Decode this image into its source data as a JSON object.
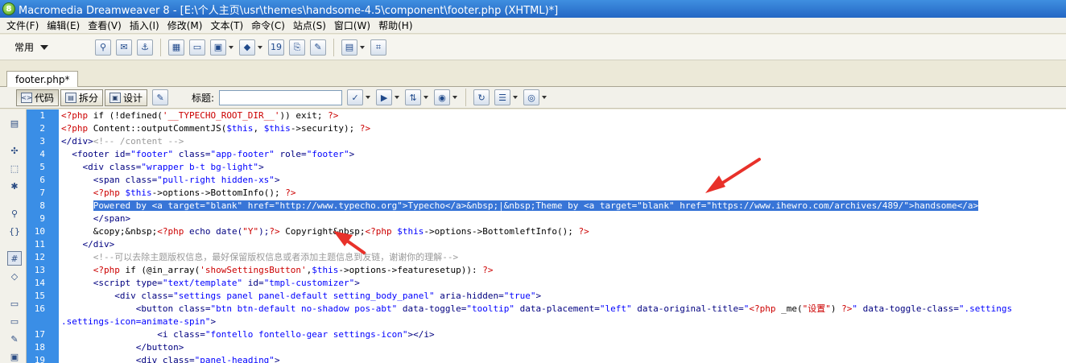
{
  "window": {
    "title": "Macromedia Dreamweaver 8 - [E:\\个人主页\\usr\\themes\\handsome-4.5\\component\\footer.php (XHTML)*]",
    "app_icon_glyph": "8"
  },
  "menu": {
    "items": [
      "文件(F)",
      "编辑(E)",
      "查看(V)",
      "插入(I)",
      "修改(M)",
      "文本(T)",
      "命令(C)",
      "站点(S)",
      "窗口(W)",
      "帮助(H)"
    ]
  },
  "insert_bar": {
    "category": "常用",
    "icons": [
      "hyperlink-icon",
      "email-link-icon",
      "named-anchor-icon",
      "table-icon",
      "layer-icon",
      "image-icon",
      "media-icon",
      "date-icon",
      "server-include-icon",
      "comment-icon",
      "template-icon",
      "tag-chooser-icon"
    ]
  },
  "document": {
    "tab_label": "footer.php*",
    "view_code": "代码",
    "view_split": "拆分",
    "view_design": "设计",
    "title_label": "标题:",
    "title_value": ""
  },
  "code": {
    "line_numbers": [
      "1",
      "2",
      "3",
      "4",
      "5",
      "6",
      "7",
      "8",
      "9",
      "10",
      "11",
      "12",
      "13",
      "14",
      "15",
      "16",
      "",
      "17",
      "18",
      "19"
    ],
    "fold_marker": "−",
    "lines": [
      [
        {
          "t": "<?php",
          "c": "c-php"
        },
        {
          "t": " if (!defined(",
          "c": "c-plain"
        },
        {
          "t": "'__TYPECHO_ROOT_DIR__'",
          "c": "c-php"
        },
        {
          "t": ")) exit; ",
          "c": "c-plain"
        },
        {
          "t": "?>",
          "c": "c-php"
        }
      ],
      [
        {
          "t": "<?php",
          "c": "c-php"
        },
        {
          "t": " Content::outputCommentJS(",
          "c": "c-plain"
        },
        {
          "t": "$this",
          "c": "c-var"
        },
        {
          "t": ", ",
          "c": "c-plain"
        },
        {
          "t": "$this",
          "c": "c-var"
        },
        {
          "t": "->security); ",
          "c": "c-plain"
        },
        {
          "t": "?>",
          "c": "c-php"
        }
      ],
      [
        {
          "t": "</div>",
          "c": "c-tag"
        },
        {
          "t": "<!-- /content -->",
          "c": "c-comment"
        }
      ],
      [
        {
          "t": "  <footer ",
          "c": "c-tag"
        },
        {
          "t": "id=",
          "c": "c-attr"
        },
        {
          "t": "\"footer\"",
          "c": "c-str"
        },
        {
          "t": " class=",
          "c": "c-attr"
        },
        {
          "t": "\"app-footer\"",
          "c": "c-str"
        },
        {
          "t": " role=",
          "c": "c-attr"
        },
        {
          "t": "\"footer\"",
          "c": "c-str"
        },
        {
          "t": ">",
          "c": "c-tag"
        }
      ],
      [
        {
          "t": "    <div ",
          "c": "c-tag"
        },
        {
          "t": "class=",
          "c": "c-attr"
        },
        {
          "t": "\"wrapper b-t bg-light\"",
          "c": "c-str"
        },
        {
          "t": ">",
          "c": "c-tag"
        }
      ],
      [
        {
          "t": "      <span ",
          "c": "c-tag"
        },
        {
          "t": "class=",
          "c": "c-attr"
        },
        {
          "t": "\"pull-right hidden-xs\"",
          "c": "c-str"
        },
        {
          "t": ">",
          "c": "c-tag"
        }
      ],
      [
        {
          "t": "      ",
          "c": "c-plain"
        },
        {
          "t": "<?php",
          "c": "c-php"
        },
        {
          "t": " ",
          "c": "c-plain"
        },
        {
          "t": "$this",
          "c": "c-var"
        },
        {
          "t": "->options->BottomInfo(); ",
          "c": "c-plain"
        },
        {
          "t": "?>",
          "c": "c-php"
        }
      ],
      [
        {
          "t": "      ",
          "c": "c-plain"
        },
        {
          "t": "Powered by <a target=\"blank\" href=\"http://www.typecho.org\">Typecho</a>&nbsp;|&nbsp;Theme by <a target=\"blank\" href=\"https://www.ihewro.com/archives/489/\">handsome</a>",
          "c": "selected"
        }
      ],
      [
        {
          "t": "      </span>",
          "c": "c-tag"
        }
      ],
      [
        {
          "t": "      &copy;&nbsp;",
          "c": "c-plain"
        },
        {
          "t": "<?php",
          "c": "c-php"
        },
        {
          "t": " echo date(",
          "c": "c-tag"
        },
        {
          "t": "\"Y\"",
          "c": "c-php"
        },
        {
          "t": ");",
          "c": "c-tag"
        },
        {
          "t": "?>",
          "c": "c-php"
        },
        {
          "t": " Copyright&nbsp;",
          "c": "c-plain"
        },
        {
          "t": "<?php",
          "c": "c-php"
        },
        {
          "t": " ",
          "c": "c-plain"
        },
        {
          "t": "$this",
          "c": "c-var"
        },
        {
          "t": "->options->BottomleftInfo(); ",
          "c": "c-plain"
        },
        {
          "t": "?>",
          "c": "c-php"
        }
      ],
      [
        {
          "t": "    </div>",
          "c": "c-tag"
        }
      ],
      [
        {
          "t": "      <!--可以去除主题版权信息，最好保留版权信息或者添加主题信息到友链，谢谢你的理解-->",
          "c": "c-comment"
        }
      ],
      [
        {
          "t": "      ",
          "c": "c-plain"
        },
        {
          "t": "<?php",
          "c": "c-php"
        },
        {
          "t": " if (@in_array(",
          "c": "c-plain"
        },
        {
          "t": "'showSettingsButton'",
          "c": "c-php"
        },
        {
          "t": ",",
          "c": "c-plain"
        },
        {
          "t": "$this",
          "c": "c-var"
        },
        {
          "t": "->options->featuresetup)): ",
          "c": "c-plain"
        },
        {
          "t": "?>",
          "c": "c-php"
        }
      ],
      [
        {
          "t": "      <script ",
          "c": "c-tag"
        },
        {
          "t": "type=",
          "c": "c-attr"
        },
        {
          "t": "\"text/template\"",
          "c": "c-str"
        },
        {
          "t": " id=",
          "c": "c-attr"
        },
        {
          "t": "\"tmpl-customizer\"",
          "c": "c-str"
        },
        {
          "t": ">",
          "c": "c-tag"
        }
      ],
      [
        {
          "t": "          <div ",
          "c": "c-tag"
        },
        {
          "t": "class=",
          "c": "c-attr"
        },
        {
          "t": "\"settings panel panel-default setting_body_panel\"",
          "c": "c-str"
        },
        {
          "t": " aria-hidden=",
          "c": "c-attr"
        },
        {
          "t": "\"true\"",
          "c": "c-str"
        },
        {
          "t": ">",
          "c": "c-tag"
        }
      ],
      [
        {
          "t": "              <button ",
          "c": "c-tag"
        },
        {
          "t": "class=",
          "c": "c-attr"
        },
        {
          "t": "\"btn btn-default no-shadow pos-abt\"",
          "c": "c-str"
        },
        {
          "t": " data-toggle=",
          "c": "c-attr"
        },
        {
          "t": "\"tooltip\"",
          "c": "c-str"
        },
        {
          "t": " data-placement=",
          "c": "c-attr"
        },
        {
          "t": "\"left\"",
          "c": "c-str"
        },
        {
          "t": " data-original-title=",
          "c": "c-attr"
        },
        {
          "t": "\"",
          "c": "c-str"
        },
        {
          "t": "<?php",
          "c": "c-php"
        },
        {
          "t": " _me(",
          "c": "c-plain"
        },
        {
          "t": "\"设置\"",
          "c": "c-php"
        },
        {
          "t": ") ",
          "c": "c-plain"
        },
        {
          "t": "?>",
          "c": "c-php"
        },
        {
          "t": "\"",
          "c": "c-str"
        },
        {
          "t": " data-toggle-class=",
          "c": "c-attr"
        },
        {
          "t": "\".settings",
          "c": "c-str"
        }
      ],
      [
        {
          "t": ".settings-icon=animate-spin\"",
          "c": "c-str"
        },
        {
          "t": ">",
          "c": "c-tag"
        }
      ],
      [
        {
          "t": "                  <i ",
          "c": "c-tag"
        },
        {
          "t": "class=",
          "c": "c-attr"
        },
        {
          "t": "\"fontello fontello-gear settings-icon\"",
          "c": "c-str"
        },
        {
          "t": "></i>",
          "c": "c-tag"
        }
      ],
      [
        {
          "t": "              </button>",
          "c": "c-tag"
        }
      ],
      [
        {
          "t": "              <div ",
          "c": "c-tag"
        },
        {
          "t": "class=",
          "c": "c-attr"
        },
        {
          "t": "\"panel-heading\"",
          "c": "c-str"
        },
        {
          "t": ">",
          "c": "c-tag"
        }
      ]
    ]
  },
  "colors": {
    "gutter": "#3a8ee6",
    "selection": "#3875d7",
    "annotation_arrow": "#e8312a"
  }
}
